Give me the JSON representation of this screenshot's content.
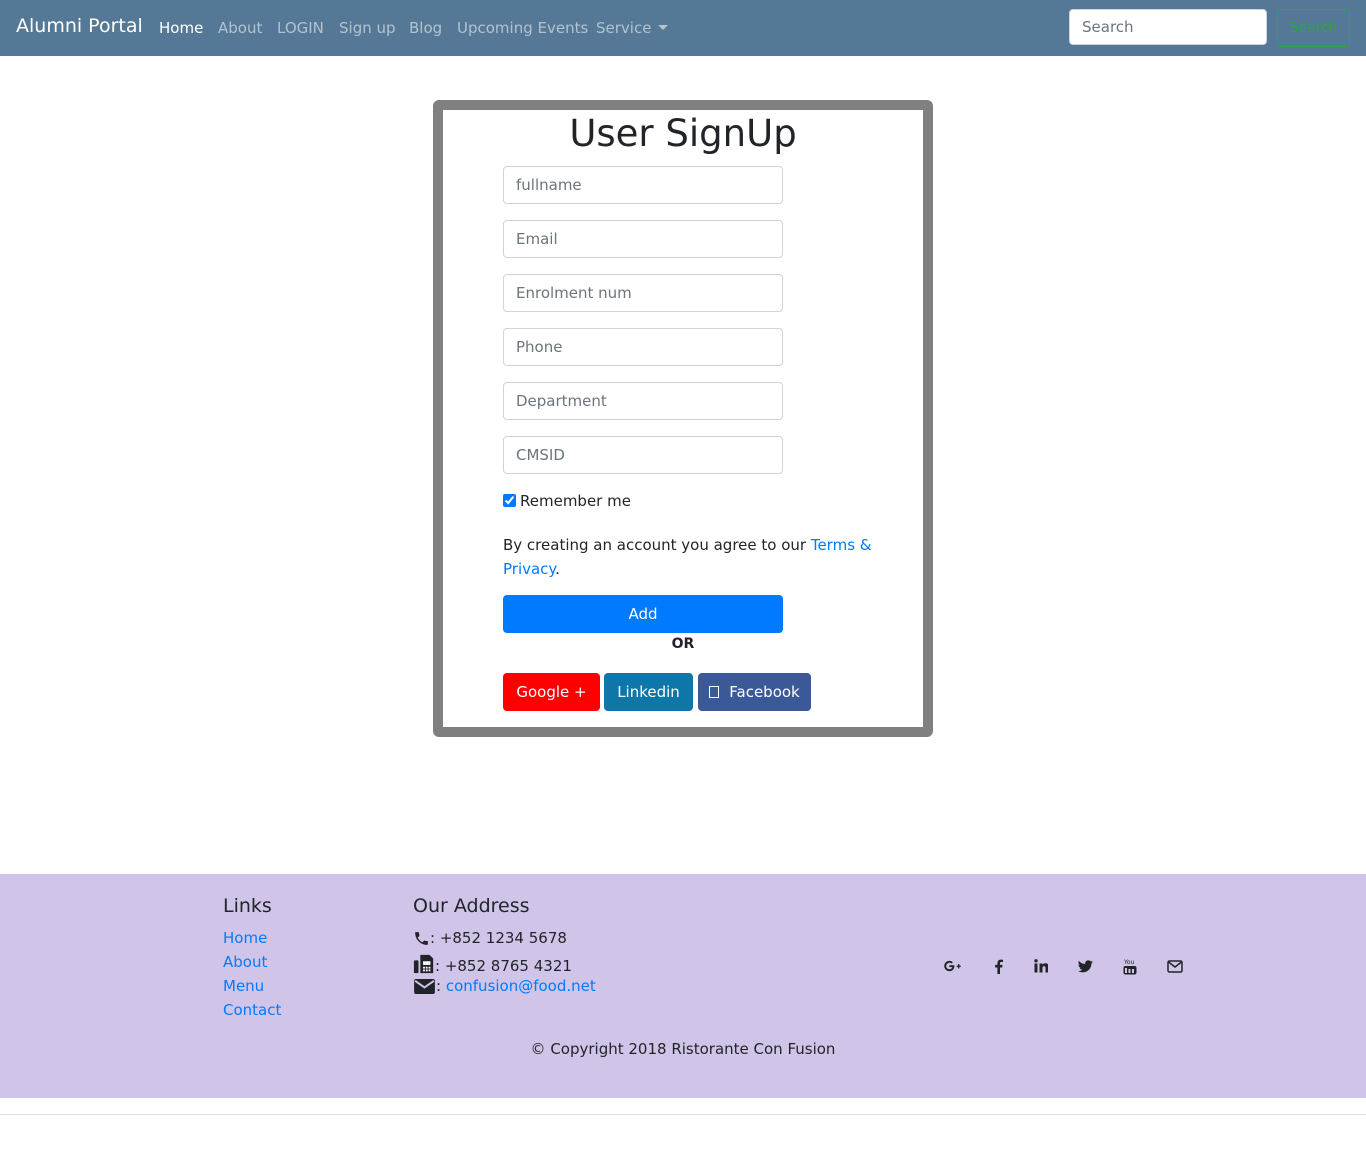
{
  "navbar": {
    "brand": "Alumni Portal",
    "links": [
      "Home",
      "About",
      "LOGIN",
      "Sign up",
      "Blog",
      "Upcoming Events",
      "Service"
    ],
    "search_placeholder": "Search",
    "search_button": "Search"
  },
  "signup": {
    "title": "User SignUp",
    "fields": [
      "fullname",
      "Email",
      "Enrolment num",
      "Phone",
      "Department",
      "CMSID"
    ],
    "remember": "Remember me",
    "remember_checked": true,
    "agree_prefix": "By creating an account you agree to our ",
    "agree_link": "Terms & Privacy",
    "agree_suffix": ".",
    "add_button": "Add",
    "or": "OR",
    "google": "Google +",
    "linkedin": "Linkedin",
    "facebook": "Facebook"
  },
  "footer": {
    "links_title": "Links",
    "links": [
      "Home",
      "About",
      "Menu",
      "Contact"
    ],
    "address_title": "Our Address",
    "phone": ": +852 1234 5678",
    "fax": ": +852 8765 4321",
    "email_prefix": ":",
    "email": "confusion@food.net",
    "social_icons": [
      "google-plus-icon",
      "facebook-icon",
      "linkedin-icon",
      "twitter-icon",
      "youtube-icon",
      "envelope-icon"
    ],
    "copyright": "© Copyright 2018 Ristorante Con Fusion"
  },
  "colors": {
    "navbar": "#547895",
    "footer": "#d1c4e9",
    "card_border": "#808080",
    "primary": "#007bff",
    "google": "#ff0000",
    "linkedin": "#0e76a8",
    "facebook": "#3b5998",
    "search_outline": "#28a745"
  }
}
